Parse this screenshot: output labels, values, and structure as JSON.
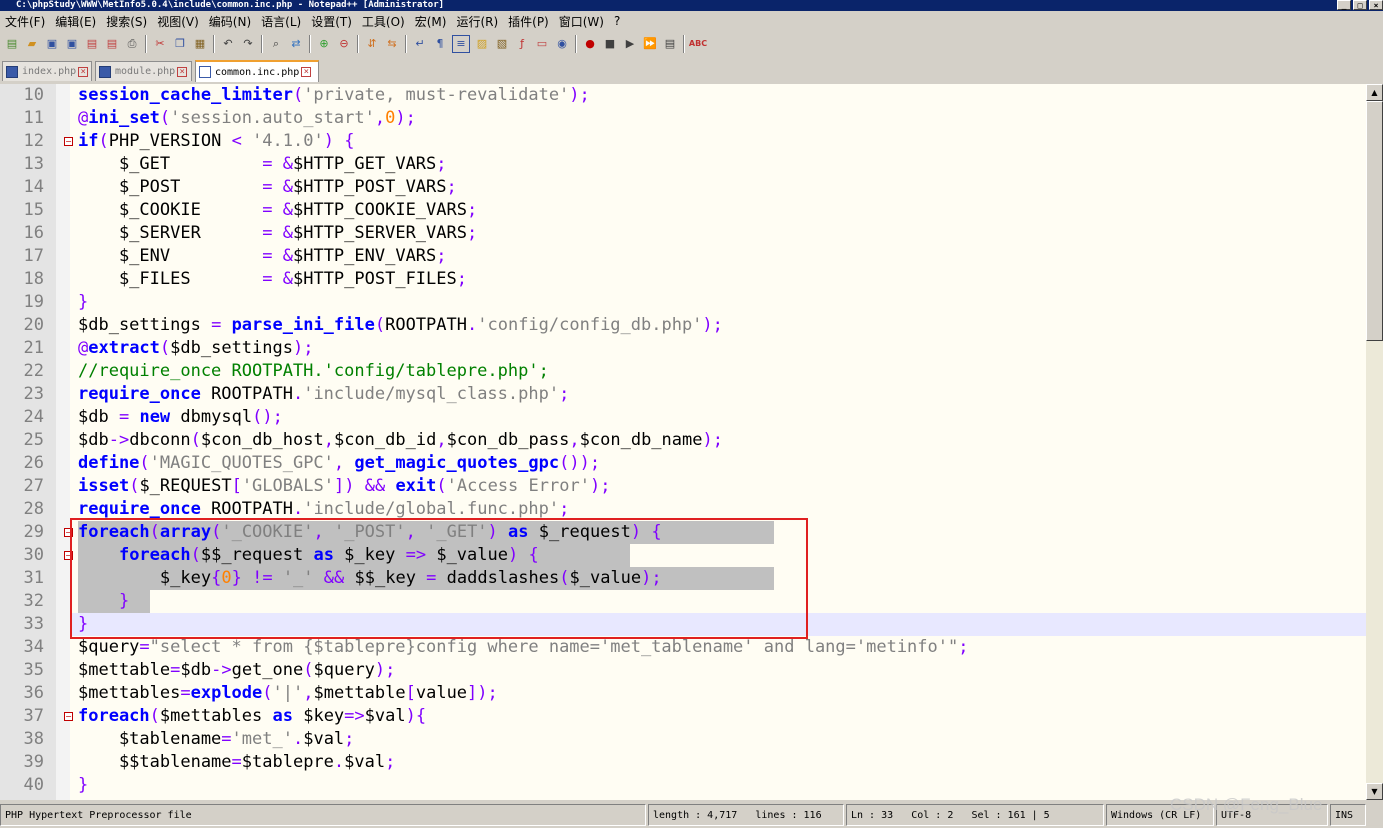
{
  "window": {
    "title": "C:\\phpStudy\\WWW\\MetInfo5.0.4\\include\\common.inc.php - Notepad++ [Administrator]"
  },
  "menu": [
    "文件(F)",
    "编辑(E)",
    "搜索(S)",
    "视图(V)",
    "编码(N)",
    "语言(L)",
    "设置(T)",
    "工具(O)",
    "宏(M)",
    "运行(R)",
    "插件(P)",
    "窗口(W)",
    "?"
  ],
  "tabs": [
    {
      "label": "index.php",
      "active": false
    },
    {
      "label": "module.php",
      "active": false
    },
    {
      "label": "common.inc.php",
      "active": true
    }
  ],
  "lines": [
    {
      "n": "10",
      "text": "session_cache_limiter('private, must-revalidate');"
    },
    {
      "n": "11",
      "text": "@ini_set('session.auto_start',0);"
    },
    {
      "n": "12",
      "text": "if(PHP_VERSION < '4.1.0') {"
    },
    {
      "n": "13",
      "text": "    $_GET         = &$HTTP_GET_VARS;"
    },
    {
      "n": "14",
      "text": "    $_POST        = &$HTTP_POST_VARS;"
    },
    {
      "n": "15",
      "text": "    $_COOKIE      = &$HTTP_COOKIE_VARS;"
    },
    {
      "n": "16",
      "text": "    $_SERVER      = &$HTTP_SERVER_VARS;"
    },
    {
      "n": "17",
      "text": "    $_ENV         = &$HTTP_ENV_VARS;"
    },
    {
      "n": "18",
      "text": "    $_FILES       = &$HTTP_POST_FILES;"
    },
    {
      "n": "19",
      "text": "}"
    },
    {
      "n": "20",
      "text": "$db_settings = parse_ini_file(ROOTPATH.'config/config_db.php');"
    },
    {
      "n": "21",
      "text": "@extract($db_settings);"
    },
    {
      "n": "22",
      "text": "//require_once ROOTPATH.'config/tablepre.php';"
    },
    {
      "n": "23",
      "text": "require_once ROOTPATH.'include/mysql_class.php';"
    },
    {
      "n": "24",
      "text": "$db = new dbmysql();"
    },
    {
      "n": "25",
      "text": "$db->dbconn($con_db_host,$con_db_id,$con_db_pass,$con_db_name);"
    },
    {
      "n": "26",
      "text": "define('MAGIC_QUOTES_GPC', get_magic_quotes_gpc());"
    },
    {
      "n": "27",
      "text": "isset($_REQUEST['GLOBALS']) && exit('Access Error');"
    },
    {
      "n": "28",
      "text": "require_once ROOTPATH.'include/global.func.php';"
    },
    {
      "n": "29",
      "text": "foreach(array('_COOKIE', '_POST', '_GET') as $_request) {"
    },
    {
      "n": "30",
      "text": "    foreach($$_request as $_key => $_value) {"
    },
    {
      "n": "31",
      "text": "        $_key{0} != '_' && $$_key = daddslashes($_value);"
    },
    {
      "n": "32",
      "text": "    }"
    },
    {
      "n": "33",
      "text": "}"
    },
    {
      "n": "34",
      "text": "$query=\"select * from {$tablepre}config where name='met_tablename' and lang='metinfo'\";"
    },
    {
      "n": "35",
      "text": "$mettable=$db->get_one($query);"
    },
    {
      "n": "36",
      "text": "$mettables=explode('|',$mettable[value]);"
    },
    {
      "n": "37",
      "text": "foreach($mettables as $key=>$val){"
    },
    {
      "n": "38",
      "text": "    $tablename='met_'.$val;"
    },
    {
      "n": "39",
      "text": "    $$tablename=$tablepre.$val;"
    },
    {
      "n": "40",
      "text": "}"
    }
  ],
  "status": {
    "filetype": "PHP Hypertext Preprocessor file",
    "length": "length : 4,717",
    "lines": "lines : 116",
    "ln": "Ln : 33",
    "col": "Col : 2",
    "sel": "Sel : 161 | 5",
    "eol": "Windows (CR LF)",
    "encoding": "UTF-8",
    "mode": "INS"
  },
  "watermark": "CSDN @Feng_Blue",
  "colors": {
    "keyword": "#0000ff",
    "string": "#808080",
    "comment": "#008000",
    "number": "#ff8000",
    "operator": "#8000ff",
    "highlight_box": "#e02020"
  }
}
